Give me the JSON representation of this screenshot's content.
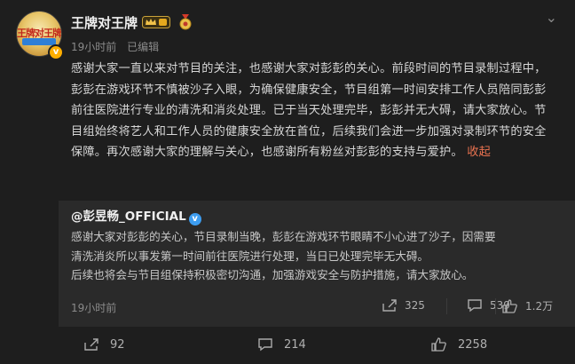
{
  "post": {
    "author": "王牌对王牌",
    "crown_icon": "crown-level-badge-icon",
    "medal_icon": "medal-icon",
    "meta": {
      "time": "19小时前",
      "edited": "已编辑"
    },
    "text": "感谢大家一直以来对节目的关注，也感谢大家对彭彭的关心。前段时间的节目录制过程中，彭彭在游戏环节不慎被沙子入眼，为确保健康安全，节目组第一时间安排工作人员陪同彭彭前往医院进行专业的清洗和消炎处理。已于当天处理完毕，彭彭并无大碍，请大家放心。节目组始终将艺人和工作人员的健康安全放在首位，后续我们会进一步加强对录制环节的安全保障。再次感谢大家的理解与关心，也感谢所有粉丝对彭彭的支持与爱护。",
    "collapse_label": "收起"
  },
  "repost": {
    "user": "@彭昱畅_OFFICIAL",
    "line1": "感谢大家对彭彭的关心，节目录制当晚，彭彭在游戏环节眼睛不小心进了沙子，因需要",
    "line2": "清洗消炎所以事发第一时间前往医院进行处理，当日已处理完毕无大碍。",
    "line3": "后续也将会与节目组保持积极密切沟通，加强游戏安全与防护措施，请大家放心。",
    "time": "19小时前",
    "shares": "325",
    "comments": "539",
    "likes": "1.2万"
  },
  "footer": {
    "shares": "92",
    "comments": "214",
    "likes": "2258"
  },
  "colors": {
    "background": "#1e1e1e",
    "repost_background": "#2a2a2a",
    "accent_link": "#eb7350",
    "verified_gold": "#ffae00",
    "verified_blue": "#3d9df0"
  }
}
